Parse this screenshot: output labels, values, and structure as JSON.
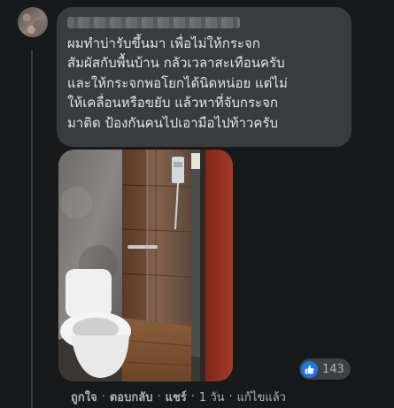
{
  "comment": {
    "author": "▒▒▒▒▒▒▒▒▒▒▒▒▒▒▒",
    "text": "ผมทำบ่ารับขึ้นมา เพื่อไม่ให้กระจก\nสัมผัสกับพื้นบ้าน กลัวเวลาสะเทือนครับ\nและให้กระจกพอโยกได้นิดหน่อย แต่ไม่\nให้เคลื่อนหรือขยับ แล้วหาที่จับกระจก\nมาติด ป้องกันคนไปเอามือไปท้าวครับ"
  },
  "reactions": {
    "icon": "like-icon",
    "count": "143",
    "color": "#1877f2"
  },
  "actions": {
    "like": "ถูกใจ",
    "reply": "ตอบกลับ",
    "share": "แชร์",
    "time": "1 วัน",
    "edited": "แก้ไขแล้ว",
    "dot": "·"
  }
}
